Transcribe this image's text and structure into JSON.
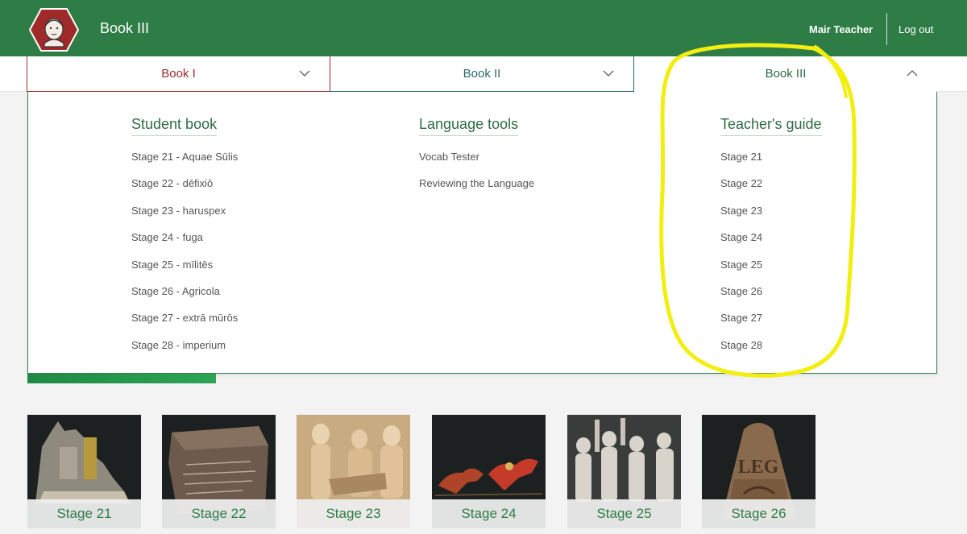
{
  "header": {
    "title": "Book III",
    "user": "Mair Teacher",
    "logout_label": "Log out",
    "color": "#2e7d47"
  },
  "tabs": [
    {
      "label": "Book I",
      "color": "#9b2c2c",
      "icon": "chevron-down-icon"
    },
    {
      "label": "Book II",
      "color": "#2b6b6b",
      "icon": "chevron-down-icon"
    },
    {
      "label": "Book III",
      "color": "#2e6b43",
      "icon": "chevron-up-icon",
      "expanded": true
    }
  ],
  "menu": {
    "student": {
      "heading": "Student book",
      "items": [
        "Stage 21 - Aquae Sūlis",
        "Stage 22 - dēfixiō",
        "Stage 23 - haruspex",
        "Stage 24 - fuga",
        "Stage 25 - mīlitēs",
        "Stage 26 - Agricola",
        "Stage 27 - extrā mūrōs",
        "Stage 28 - imperium"
      ]
    },
    "language": {
      "heading": "Language tools",
      "items": [
        "Vocab Tester",
        "Reviewing the Language"
      ]
    },
    "teacher": {
      "heading": "Teacher's guide",
      "items": [
        "Stage 21",
        "Stage 22",
        "Stage 23",
        "Stage 24",
        "Stage 25",
        "Stage 26",
        "Stage 27",
        "Stage 28"
      ]
    }
  },
  "cards": [
    {
      "label": "Stage 21"
    },
    {
      "label": "Stage 22"
    },
    {
      "label": "Stage 23"
    },
    {
      "label": "Stage 24"
    },
    {
      "label": "Stage 25"
    },
    {
      "label": "Stage 26"
    }
  ],
  "annotation": {
    "color": "#f2ee10"
  }
}
